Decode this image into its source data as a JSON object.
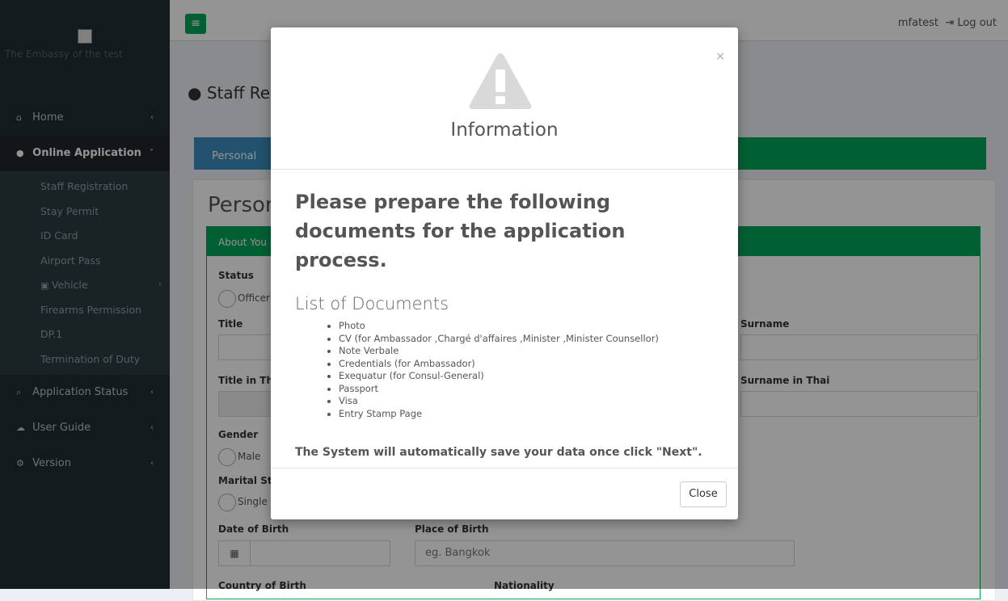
{
  "brand": {
    "name": "The Embassy of the test"
  },
  "header": {
    "menu_icon": "bars-icon",
    "username": "mfatest",
    "logout_label": "Log out",
    "logout_icon": "sign-out-icon"
  },
  "sidebar": {
    "items": [
      {
        "label": "Home",
        "icon": "home-icon"
      },
      {
        "label": "Online Application",
        "icon": "user-icon"
      },
      {
        "label": "Application Status",
        "icon": "search-icon"
      },
      {
        "label": "User Guide",
        "icon": "cloud-icon"
      },
      {
        "label": "Version",
        "icon": "cogs-icon"
      }
    ],
    "subitems": [
      "Staff Registration",
      "Stay Permit",
      "ID Card",
      "Airport Pass",
      "Vehicle",
      "Firearms Permission",
      "DP.1",
      "Termination of Duty"
    ]
  },
  "page": {
    "title": "Staff Registration"
  },
  "tab": {
    "label": "Personal Information"
  },
  "panel": {
    "heading": "Personal Information"
  },
  "form": {
    "box_title": "About You",
    "status_label": "Status",
    "status_option": "Officer",
    "title_label": "Title",
    "surname_label": "Surname",
    "title_thai_label": "Title in Thai",
    "surname_thai_label": "Surname in Thai",
    "gender_label": "Gender",
    "gender_option": "Male",
    "marital_label": "Marital Status",
    "marital_option": "Single",
    "dob_label": "Date of Birth",
    "pob_label": "Place of Birth",
    "pob_placeholder": "eg. Bangkok",
    "country_label": "Country of Birth",
    "nationality_label": "Nationality"
  },
  "modal": {
    "title": "Information",
    "close_symbol": "×",
    "lead": "Please prepare the following documents for the application process.",
    "docs_title": "List of Documents",
    "docs": [
      "Photo",
      "CV (for Ambassador ,Chargé d'affaires ,Minister ,Minister Counsellor)",
      "Note Verbale",
      "Credentials (for Ambassador)",
      "Exequatur (for Consul-General)",
      "Passport",
      "Visa",
      "Entry Stamp Page"
    ],
    "note": "The System will automatically save your data once click \"Next\".",
    "close_button": "Close"
  },
  "colors": {
    "sidebar": "#222d32",
    "accent_green": "#00a65a",
    "tab_blue": "#3c8dbc"
  }
}
